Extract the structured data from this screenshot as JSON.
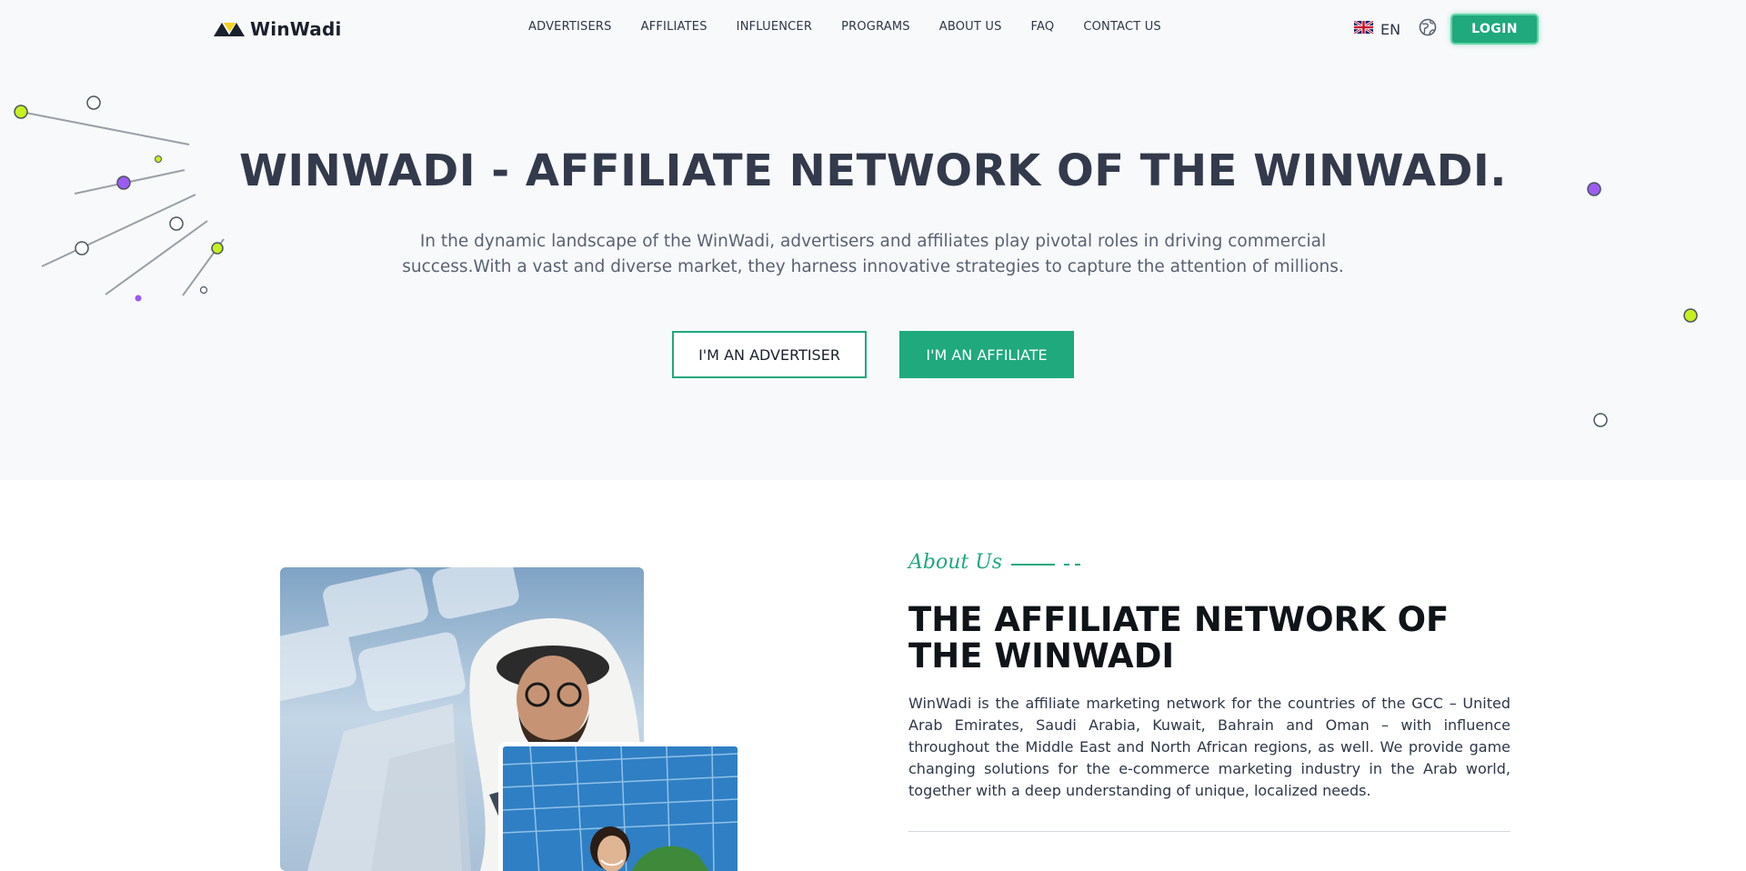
{
  "header": {
    "logo_text": "WinWadi",
    "nav": [
      "ADVERTISERS",
      "AFFILIATES",
      "INFLUENCER",
      "PROGRAMS",
      "ABOUT US",
      "FAQ",
      "CONTACT US"
    ],
    "language": "EN",
    "login_label": "LOGIN"
  },
  "hero": {
    "title": "WINWADI - AFFILIATE NETWORK OF THE WINWADI.",
    "description": "In the dynamic landscape of the WinWadi, advertisers and affiliates play pivotal roles in driving commercial success.With a vast and diverse market, they harness innovative strategies to capture the attention of millions.",
    "advertiser_button": "I'M AN ADVERTISER",
    "affiliate_button": "I'M AN AFFILIATE"
  },
  "about": {
    "tag": "About Us",
    "heading": "THE AFFILIATE NETWORK OF THE WINWADI",
    "body": "WinWadi is the affiliate marketing network for the countries of the GCC – United Arab Emirates, Saudi Arabia, Kuwait, Bahrain and Oman – with influence throughout the Middle East and North African regions, as well. We provide game changing solutions for the e-commerce marketing industry in the Arab world, together with a deep understanding of unique, localized needs."
  },
  "colors": {
    "accent": "#1fa97c",
    "hero_bg": "#f7f9fb",
    "title": "#323a4b",
    "deco_lime": "#c6f01e",
    "deco_purple": "#9b5cf0"
  }
}
